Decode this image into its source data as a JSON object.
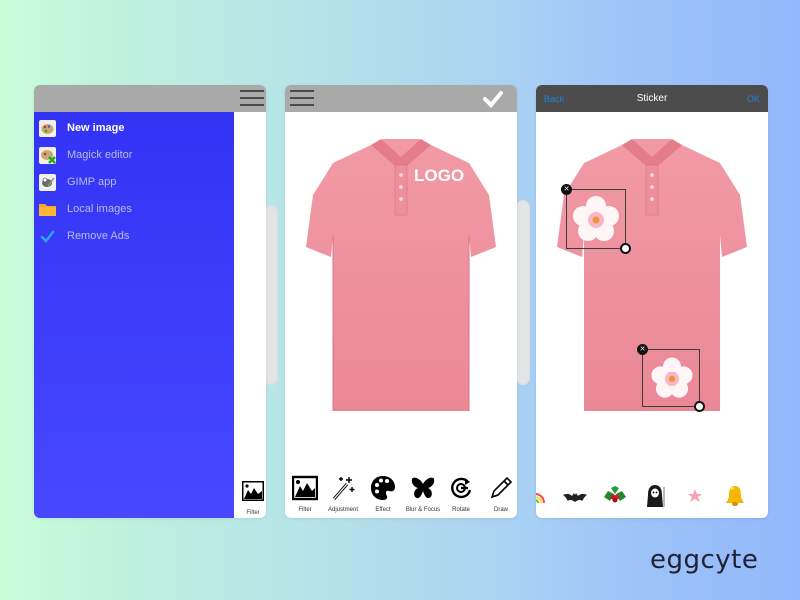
{
  "brand": {
    "name": "eggcyte"
  },
  "screen1": {
    "menu": [
      {
        "label": "New image",
        "icon": "palette-icon",
        "active": true
      },
      {
        "label": "Magick editor",
        "icon": "magick-editor-icon",
        "active": false
      },
      {
        "label": "GIMP app",
        "icon": "gimp-icon",
        "active": false
      },
      {
        "label": "Local images",
        "icon": "folder-icon",
        "active": false
      },
      {
        "label": "Remove Ads",
        "icon": "checkmark-icon",
        "active": false
      }
    ],
    "peek_tool": {
      "label": "Filter",
      "icon": "image-filter-icon"
    }
  },
  "screen2": {
    "logo_text": "LOGO",
    "tools": [
      {
        "label": "Filter",
        "icon": "image-filter-icon"
      },
      {
        "label": "Adjustment",
        "icon": "magic-wand-icon"
      },
      {
        "label": "Effect",
        "icon": "palette-icon"
      },
      {
        "label": "Blur & Focus",
        "icon": "butterfly-icon"
      },
      {
        "label": "Rotate",
        "icon": "rotate-icon"
      },
      {
        "label": "Draw",
        "icon": "pencil-icon"
      }
    ]
  },
  "screen3": {
    "back_label": "Back",
    "title": "Sticker",
    "ok_label": "OK",
    "stickers_on_canvas": 2,
    "tray": [
      {
        "name": "rainbow"
      },
      {
        "name": "bat"
      },
      {
        "name": "holly"
      },
      {
        "name": "grim-reaper"
      },
      {
        "name": "pink-star"
      },
      {
        "name": "bell"
      }
    ]
  },
  "colors": {
    "drawer_blue": "#3b3cfa",
    "topbar_gray": "#a9a9a9",
    "topbar_dark": "#4c4c4d",
    "nav_link_blue": "#1e82d8",
    "shirt_pink": "#ee8e9b"
  }
}
